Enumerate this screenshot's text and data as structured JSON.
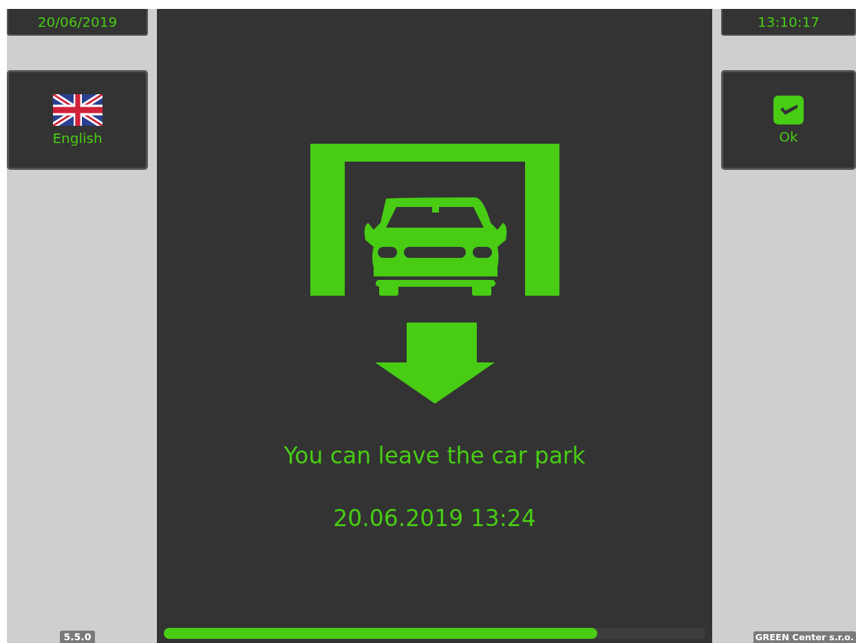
{
  "date": "20/06/2019",
  "time": "13:10:17",
  "language_button": {
    "label": "English"
  },
  "ok_button": {
    "label": "Ok"
  },
  "message": "You can leave the car park",
  "exit_time": "20.06.2019 13:24",
  "progress": {
    "level": 0.8
  },
  "version": "5.5.0",
  "company": "GREEN Center s.r.o."
}
